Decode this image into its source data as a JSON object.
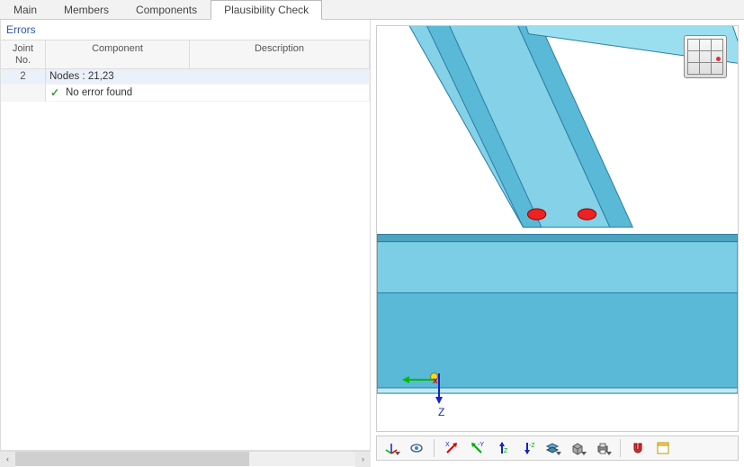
{
  "tabs": {
    "items": [
      {
        "label": "Main"
      },
      {
        "label": "Members"
      },
      {
        "label": "Components"
      },
      {
        "label": "Plausibility Check"
      }
    ],
    "active_index": 3
  },
  "panel": {
    "title": "Errors"
  },
  "grid": {
    "headers": {
      "joint_no": "Joint\nNo.",
      "component": "Component",
      "description": "Description"
    },
    "rows": {
      "joint_no": "2",
      "nodes_label": "Nodes : 21,23",
      "status_text": "No error found"
    }
  },
  "axes": {
    "z_label": "Z"
  },
  "toolbar": {
    "tips": {
      "ucs": "UCS",
      "eye": "View",
      "axis_x": "+X",
      "axis_y": "+Y",
      "axis_z": "+Z",
      "axis_nz": "-Z",
      "layers": "Display",
      "box": "Box",
      "print": "Print",
      "magnet": "Snap",
      "new": "New Window"
    }
  }
}
